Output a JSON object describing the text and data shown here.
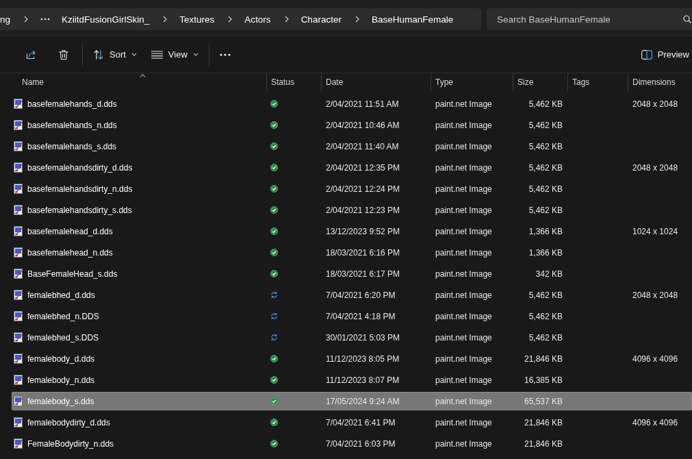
{
  "address_bar": {
    "breadcrumbs": [
      {
        "kind": "folder",
        "label": "ng"
      },
      {
        "kind": "overflow"
      },
      {
        "kind": "folder",
        "label": "KziitdFusionGirlSkin_"
      },
      {
        "kind": "folder",
        "label": "Textures"
      },
      {
        "kind": "folder",
        "label": "Actors"
      },
      {
        "kind": "folder",
        "label": "Character"
      },
      {
        "kind": "folder",
        "label": "BaseHumanFemale"
      }
    ]
  },
  "search": {
    "placeholder": "Search BaseHumanFemale"
  },
  "toolbar": {
    "items": [
      {
        "kind": "share"
      },
      {
        "kind": "delete"
      },
      {
        "kind": "separator"
      },
      {
        "kind": "sort",
        "label": "Sort"
      },
      {
        "kind": "view",
        "label": "View"
      },
      {
        "kind": "separator"
      },
      {
        "kind": "more"
      }
    ],
    "preview": {
      "label": "Preview"
    }
  },
  "table": {
    "columns": [
      {
        "label": "Name",
        "sorted": true
      },
      {
        "label": "Status",
        "sorted": false
      },
      {
        "label": "Date",
        "sorted": false
      },
      {
        "label": "Type",
        "sorted": false
      },
      {
        "label": "Size",
        "sorted": false
      },
      {
        "label": "Tags",
        "sorted": false
      },
      {
        "label": "Dimensions",
        "sorted": false
      }
    ],
    "rows": [
      {
        "name": "basefemalehands_d.dds",
        "syncing": false,
        "date": "2/04/2021 11:51 AM",
        "type": "paint.net Image",
        "size": "5,462 KB",
        "dimensions": "2048 x 2048",
        "selected": false
      },
      {
        "name": "basefemalehands_n.dds",
        "syncing": false,
        "date": "2/04/2021 10:46 AM",
        "type": "paint.net Image",
        "size": "5,462 KB",
        "selected": false
      },
      {
        "name": "basefemalehands_s.dds",
        "syncing": false,
        "date": "2/04/2021 11:40 AM",
        "type": "paint.net Image",
        "size": "5,462 KB",
        "selected": false
      },
      {
        "name": "basefemalehandsdirty_d.dds",
        "syncing": false,
        "date": "2/04/2021 12:35 PM",
        "type": "paint.net Image",
        "size": "5,462 KB",
        "dimensions": "2048 x 2048",
        "selected": false
      },
      {
        "name": "basefemalehandsdirty_n.dds",
        "syncing": false,
        "date": "2/04/2021 12:24 PM",
        "type": "paint.net Image",
        "size": "5,462 KB",
        "selected": false
      },
      {
        "name": "basefemalehandsdirty_s.dds",
        "syncing": false,
        "date": "2/04/2021 12:23 PM",
        "type": "paint.net Image",
        "size": "5,462 KB",
        "selected": false
      },
      {
        "name": "basefemalehead_d.dds",
        "syncing": false,
        "date": "13/12/2023 9:52 PM",
        "type": "paint.net Image",
        "size": "1,366 KB",
        "dimensions": "1024 x 1024",
        "selected": false
      },
      {
        "name": "basefemalehead_n.dds",
        "syncing": false,
        "date": "18/03/2021 6:16 PM",
        "type": "paint.net Image",
        "size": "1,366 KB",
        "selected": false
      },
      {
        "name": "BaseFemaleHead_s.dds",
        "syncing": false,
        "date": "18/03/2021 6:17 PM",
        "type": "paint.net Image",
        "size": "342 KB",
        "selected": false
      },
      {
        "name": "femalebhed_d.dds",
        "syncing": true,
        "date": "7/04/2021 6:20 PM",
        "type": "paint.net Image",
        "size": "5,462 KB",
        "dimensions": "2048 x 2048",
        "selected": false
      },
      {
        "name": "femalebhed_n.DDS",
        "syncing": true,
        "date": "7/04/2021 4:18 PM",
        "type": "paint.net Image",
        "size": "5,462 KB",
        "selected": false
      },
      {
        "name": "femalebhed_s.DDS",
        "syncing": true,
        "date": "30/01/2021 5:03 PM",
        "type": "paint.net Image",
        "size": "5,462 KB",
        "selected": false
      },
      {
        "name": "femalebody_d.dds",
        "syncing": false,
        "date": "11/12/2023 8:05 PM",
        "type": "paint.net Image",
        "size": "21,846 KB",
        "dimensions": "4096 x 4096",
        "selected": false
      },
      {
        "name": "femalebody_n.dds",
        "syncing": false,
        "date": "11/12/2023 8:07 PM",
        "type": "paint.net Image",
        "size": "16,385 KB",
        "selected": false
      },
      {
        "name": "femalebody_s.dds",
        "syncing": false,
        "date": "17/05/2024 9:24 AM",
        "type": "paint.net Image",
        "size": "65,537 KB",
        "selected": true
      },
      {
        "name": "femalebodydirty_d.dds",
        "syncing": false,
        "date": "7/04/2021 6:41 PM",
        "type": "paint.net Image",
        "size": "21,846 KB",
        "dimensions": "4096 x 4096",
        "selected": false
      },
      {
        "name": "FemaleBodydirty_n.dds",
        "syncing": false,
        "date": "7/04/2021 6:03 PM",
        "type": "paint.net Image",
        "size": "21,846 KB",
        "selected": false
      }
    ]
  }
}
